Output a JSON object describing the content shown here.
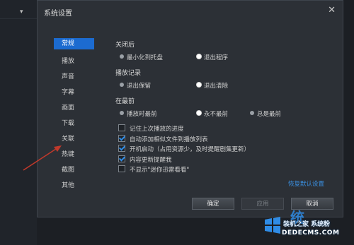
{
  "dialog": {
    "title": "系统设置",
    "close_glyph": "✕"
  },
  "nav": {
    "items": [
      {
        "label": "常规",
        "active": true
      },
      {
        "label": "播放",
        "active": false
      },
      {
        "label": "声音",
        "active": false
      },
      {
        "label": "字幕",
        "active": false
      },
      {
        "label": "画面",
        "active": false
      },
      {
        "label": "下载",
        "active": false
      },
      {
        "label": "关联",
        "active": false
      },
      {
        "label": "热键",
        "active": false
      },
      {
        "label": "截图",
        "active": false
      },
      {
        "label": "其他",
        "active": false
      }
    ]
  },
  "sections": {
    "on_close": {
      "title": "关闭后",
      "options": [
        {
          "label": "最小化到托盘",
          "selected": false
        },
        {
          "label": "退出程序",
          "selected": true
        }
      ]
    },
    "history": {
      "title": "播放记录",
      "options": [
        {
          "label": "退出保留",
          "selected": false
        },
        {
          "label": "退出清除",
          "selected": true
        }
      ]
    },
    "topmost": {
      "title": "在最前",
      "options": [
        {
          "label": "播放时最前",
          "selected": false
        },
        {
          "label": "永不最前",
          "selected": true
        },
        {
          "label": "总是最前",
          "selected": false
        }
      ]
    }
  },
  "checkboxes": [
    {
      "label": "记住上次播放的进度",
      "checked": false
    },
    {
      "label": "自动添加相似文件到播放列表",
      "checked": true
    },
    {
      "label": "开机启动（占用资源少，及时提醒剧集更新）",
      "checked": true
    },
    {
      "label": "内容更新提醒我",
      "checked": true
    },
    {
      "label": "不显示\"迷你迅雷看看\"",
      "checked": false
    }
  ],
  "restore_link": "恢复默认设置",
  "buttons": {
    "ok": "确定",
    "apply": "应用",
    "cancel": "取消"
  },
  "watermark": {
    "big_char": "统",
    "main": "装机之家 系统粉",
    "url": "DEDECMS.COM"
  },
  "colors": {
    "accent": "#1c6bd0",
    "link": "#3a8fe0",
    "arrow": "#c0392b"
  }
}
